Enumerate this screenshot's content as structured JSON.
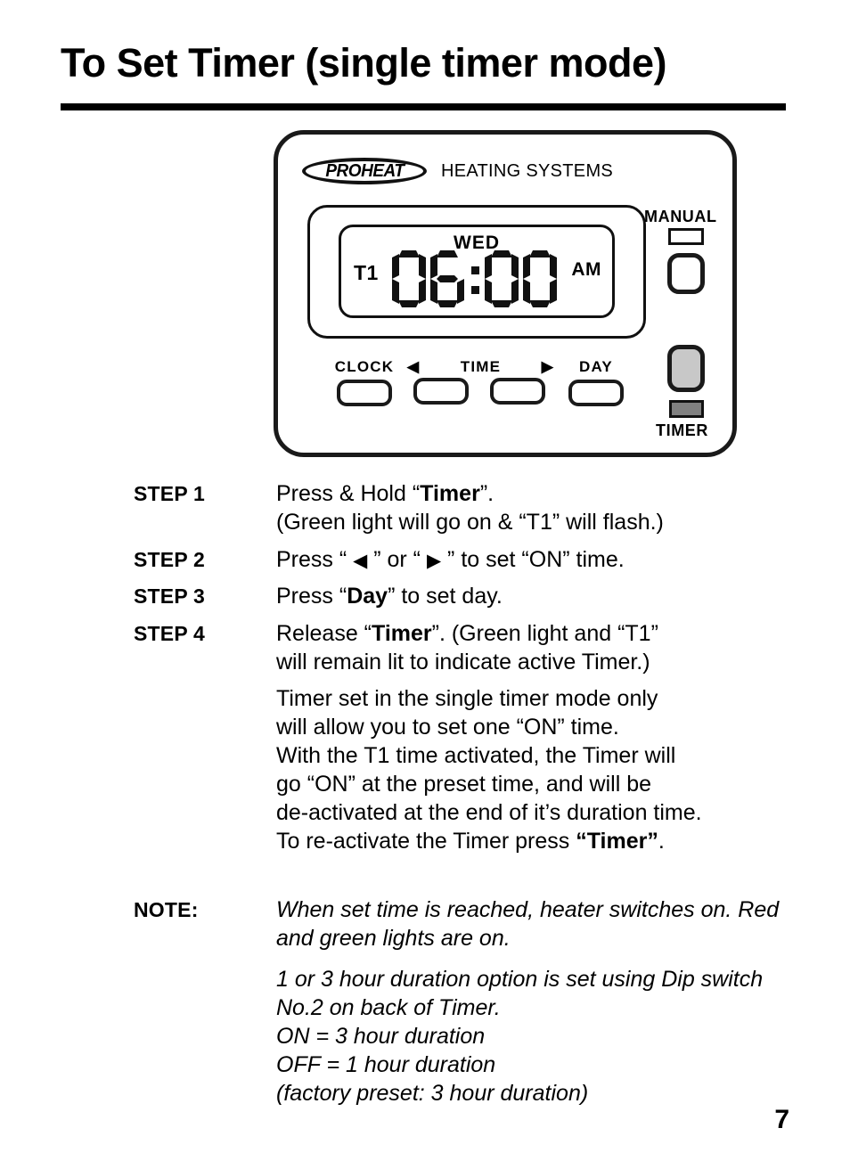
{
  "page": {
    "title": "To Set Timer (single timer mode)",
    "number": "7"
  },
  "device": {
    "brand": "PROHEAT",
    "brand_subtitle": "HEATING SYSTEMS",
    "lcd": {
      "day": "WED",
      "timer_indicator": "T1",
      "time": "06:00",
      "meridiem": "AM",
      "digits": [
        "0",
        "6",
        "0",
        "0"
      ]
    },
    "buttons": [
      {
        "label": "CLOCK",
        "name": "clock-button"
      },
      {
        "label": "◀",
        "name": "time-back-button"
      },
      {
        "label": "TIME",
        "name": "time-label"
      },
      {
        "label": "▶",
        "name": "time-forward-button"
      },
      {
        "label": "DAY",
        "name": "day-button"
      }
    ],
    "indicators": {
      "manual_label": "MANUAL",
      "timer_label": "TIMER",
      "manual_led_color": "#ffffff",
      "timer_button_color": "#c8c8c8",
      "timer_led_color": "#808080"
    }
  },
  "steps": [
    {
      "label": "STEP 1",
      "lines": [
        [
          {
            "t": "Press & Hold “",
            "b": false
          },
          {
            "t": "Timer",
            "b": true
          },
          {
            "t": "”.",
            "b": false
          }
        ],
        [
          {
            "t": "(Green light will go on & “T1” will flash.)",
            "b": false
          }
        ]
      ]
    },
    {
      "label": "STEP 2",
      "lines": [
        [
          {
            "t": "Press “ ",
            "b": false
          },
          {
            "t": "◀",
            "b": false,
            "arrow": true
          },
          {
            "t": " ” or “ ",
            "b": false
          },
          {
            "t": "▶",
            "b": false,
            "arrow": true
          },
          {
            "t": " ” to set “ON” time.",
            "b": false
          }
        ]
      ]
    },
    {
      "label": "STEP 3",
      "lines": [
        [
          {
            "t": "Press “",
            "b": false
          },
          {
            "t": "Day",
            "b": true
          },
          {
            "t": "” to set day.",
            "b": false
          }
        ]
      ]
    },
    {
      "label": "STEP 4",
      "lines": [
        [
          {
            "t": "Release “",
            "b": false
          },
          {
            "t": "Timer",
            "b": true
          },
          {
            "t": "”. (Green light and “T1”",
            "b": false
          }
        ],
        [
          {
            "t": "will remain lit to indicate active Timer.)",
            "b": false
          }
        ]
      ]
    }
  ],
  "step4_paragraph": [
    [
      {
        "t": "Timer set in the single timer mode only",
        "b": false
      }
    ],
    [
      {
        "t": "will allow you to set one “ON” time.",
        "b": false
      }
    ],
    [
      {
        "t": "With the T1 time activated, the Timer will",
        "b": false
      }
    ],
    [
      {
        "t": "go “ON” at the preset time, and will be",
        "b": false
      }
    ],
    [
      {
        "t": "de-activated at the end of it’s duration time.",
        "b": false
      }
    ],
    [
      {
        "t": "To re-activate the Timer press ",
        "b": false
      },
      {
        "t": "“Timer”",
        "b": true
      },
      {
        "t": ".",
        "b": false
      }
    ]
  ],
  "note": {
    "label": "NOTE:",
    "paragraphs": [
      "When set time is reached, heater switches on. Red and green lights are on.",
      "1 or 3 hour duration option is set using Dip switch No.2 on back of Timer.\nON = 3 hour duration\nOFF = 1 hour duration\n(factory preset: 3 hour duration)"
    ]
  }
}
